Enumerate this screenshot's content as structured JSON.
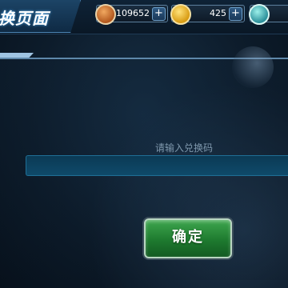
{
  "header": {
    "title": "换页面",
    "resources": [
      {
        "name": "copper-coin",
        "value": "109652",
        "plus": "+"
      },
      {
        "name": "gold-coin",
        "value": "425",
        "plus": "+"
      },
      {
        "name": "gem",
        "value": "",
        "plus": ""
      }
    ]
  },
  "redeem": {
    "prompt": "请输入兑换码",
    "input_value": "",
    "confirm_label": "确定"
  },
  "colors": {
    "accent": "#4c86b6",
    "confirm_green": "#2e9441"
  }
}
